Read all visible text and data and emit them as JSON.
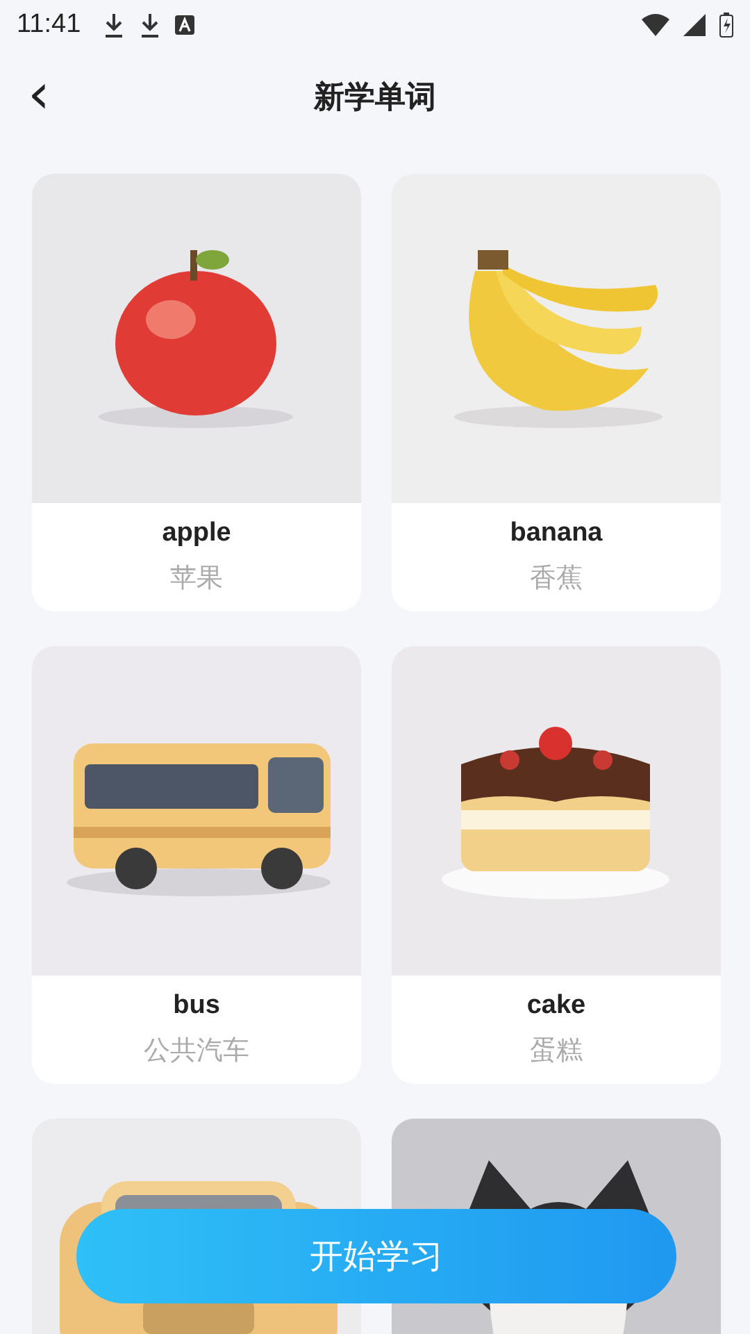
{
  "status_bar": {
    "time": "11:41"
  },
  "header": {
    "back_icon": "‹",
    "title": "新学单词"
  },
  "cards": [
    {
      "kind": "word",
      "word": "apple",
      "translation": "苹果"
    },
    {
      "kind": "word",
      "word": "banana",
      "translation": "香蕉"
    },
    {
      "kind": "word",
      "word": "bus",
      "translation": "公共汽车"
    },
    {
      "kind": "word",
      "word": "cake",
      "translation": "蛋糕"
    },
    {
      "kind": "picture"
    },
    {
      "kind": "picture"
    }
  ],
  "start_button": {
    "label": "开始学习"
  }
}
